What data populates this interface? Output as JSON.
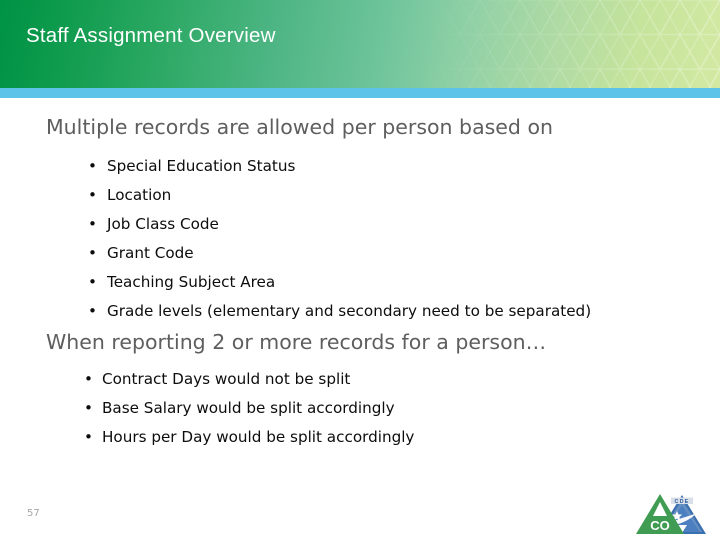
{
  "slide": {
    "header": {
      "title": "Staff Assignment Overview",
      "gradient_start": "#009245",
      "gradient_end": "#d3e9a3",
      "accent_strip_color": "#5ec3e8",
      "pattern_name": "triangle-lattice-pattern"
    },
    "sections": [
      {
        "heading": "Multiple records are allowed per person based on",
        "bullet_marker": "•",
        "items": [
          "Special Education Status",
          "Location",
          "Job Class Code",
          "Grant Code",
          "Teaching Subject Area",
          "Grade levels (elementary and secondary need to be separated)"
        ]
      },
      {
        "heading": "When reporting 2 or more records for a person…",
        "bullet_marker": "•",
        "items": [
          "Contract Days would not be split",
          "Base Salary would be split accordingly",
          "Hours per Day would be split accordingly"
        ]
      }
    ],
    "footer": {
      "page_number": "57",
      "logos": [
        {
          "name": "colorado-co-logo",
          "text": "CO",
          "color": "#3f9c52"
        },
        {
          "name": "cde-logo",
          "text": "CDE",
          "color": "#3a6fb0"
        }
      ]
    },
    "colors": {
      "heading_text": "#5e5e5e",
      "body_text": "#0d0d0d",
      "page_number_text": "#a6a6a6",
      "background": "#ffffff"
    }
  }
}
